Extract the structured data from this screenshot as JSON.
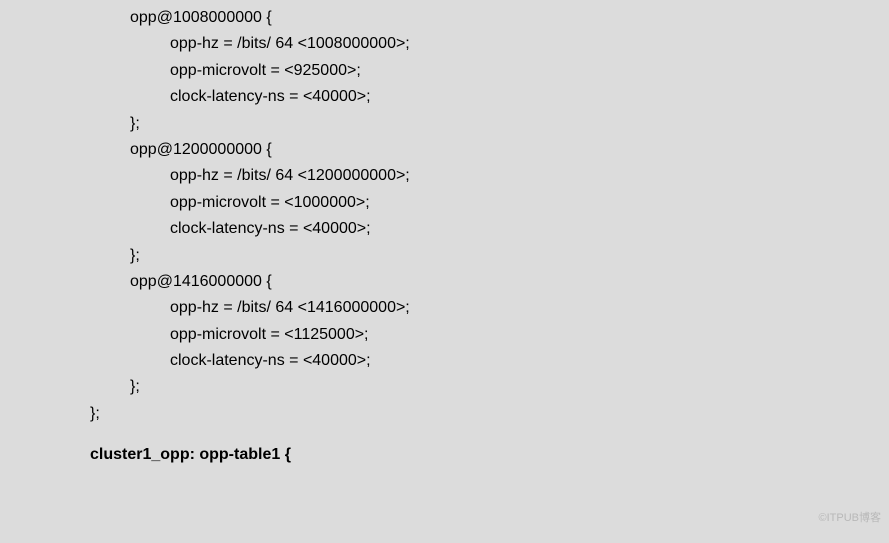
{
  "code": {
    "block1": {
      "header": "opp@1008000000 {",
      "hz": "opp-hz = /bits/ 64 <1008000000>;",
      "microvolt": "opp-microvolt = <925000>;",
      "latency": "clock-latency-ns = <40000>;",
      "close": "};"
    },
    "block2": {
      "header": "opp@1200000000 {",
      "hz": "opp-hz = /bits/ 64 <1200000000>;",
      "microvolt": "opp-microvolt = <1000000>;",
      "latency": "clock-latency-ns = <40000>;",
      "close": "};"
    },
    "block3": {
      "header": "opp@1416000000 {",
      "hz": "opp-hz = /bits/ 64 <1416000000>;",
      "microvolt": "opp-microvolt = <1125000>;",
      "latency": "clock-latency-ns = <40000>;",
      "close": "};"
    },
    "outerClose": "};",
    "cluster1": "cluster1_opp: opp-table1 {"
  },
  "watermark": "©ITPUB博客"
}
